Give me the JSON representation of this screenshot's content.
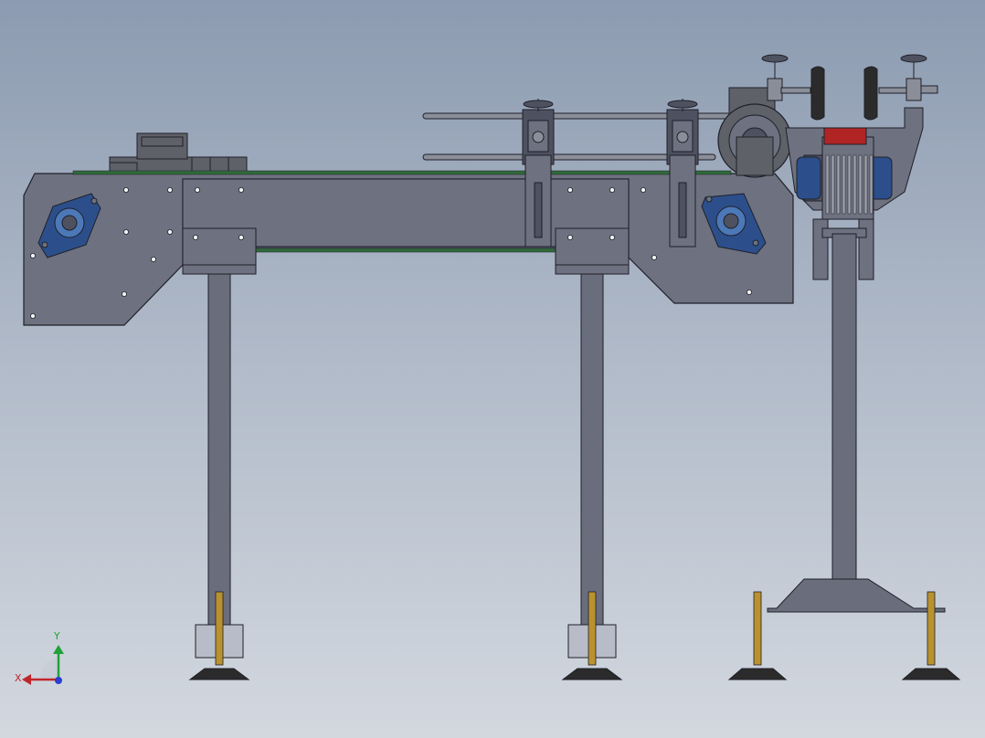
{
  "scene": {
    "view": "front",
    "assembly": "conveyor",
    "triad": {
      "x_label": "X",
      "y_label": "Y"
    },
    "colors": {
      "frame": "#6e7180",
      "frame_dark": "#4e5160",
      "leg": "#6a6d7c",
      "outline": "#1f2028",
      "belt": "#2f6b3a",
      "bearing": "#2c4f8c",
      "bearing_light": "#4c78b8",
      "motor": "#5f6169",
      "screw": "#b9912e",
      "foot": "#2b2b2b",
      "pad": "#b8bcc8",
      "red_block": "#b02424",
      "rod": "#8a8e99",
      "axis_x": "#c0262b",
      "axis_y": "#21a13a",
      "axis_z": "#2a3fd0"
    }
  }
}
